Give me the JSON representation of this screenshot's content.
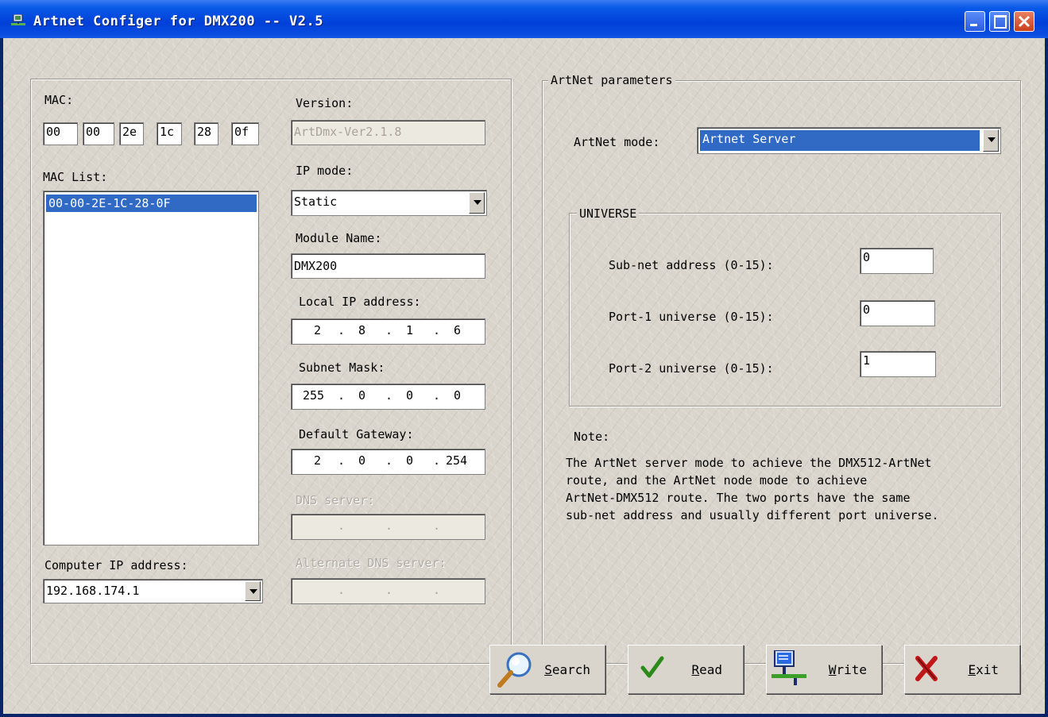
{
  "window": {
    "title": "Artnet Configer for DMX200 -- V2.5"
  },
  "left": {
    "mac_label": "MAC:",
    "mac_octets": [
      "00",
      "00",
      "2e",
      "1c",
      "28",
      "0f"
    ],
    "mac_list_label": "MAC List:",
    "mac_list_items": [
      "00-00-2E-1C-28-0F"
    ],
    "computer_ip_label": "Computer IP address:",
    "computer_ip_value": "192.168.174.1"
  },
  "middle": {
    "version_label": "Version:",
    "version_value": "ArtDmx-Ver2.1.8",
    "ip_mode_label": "IP mode:",
    "ip_mode_value": "Static",
    "module_name_label": "Module Name:",
    "module_name_value": "DMX200",
    "local_ip_label": "Local IP address:",
    "local_ip": [
      "2",
      "8",
      "1",
      "6"
    ],
    "subnet_mask_label": "Subnet Mask:",
    "subnet_mask": [
      "255",
      "0",
      "0",
      "0"
    ],
    "gateway_label": "Default Gateway:",
    "gateway": [
      "2",
      "0",
      "0",
      "254"
    ],
    "dns_label": "DNS server:",
    "alt_dns_label": "Alternate DNS server:"
  },
  "artnet": {
    "group_label": "ArtNet parameters",
    "mode_label": "ArtNet mode:",
    "mode_value": "Artnet Server",
    "universe_group_label": "UNIVERSE",
    "subnet_label": "Sub-net address (0-15):",
    "subnet_value": "0",
    "port1_label": "Port-1 universe (0-15):",
    "port1_value": "0",
    "port2_label": "Port-2 universe (0-15):",
    "port2_value": "1",
    "note_label": "Note:",
    "note_lines": [
      "The ArtNet server mode to achieve the DMX512-ArtNet",
      "route, and the ArtNet node mode to achieve",
      "ArtNet-DMX512 route. The two ports have the same",
      "sub-net address and usually different port universe."
    ]
  },
  "buttons": {
    "search_first": "S",
    "search_rest": "earch",
    "read_first": "R",
    "read_rest": "ead",
    "write_first": "W",
    "write_rest": "rite",
    "exit_first": "E",
    "exit_rest": "xit"
  },
  "icons": [
    "app-icon",
    "minimize-icon",
    "maximize-icon",
    "close-icon",
    "magnifier-icon",
    "checkmark-icon",
    "network-computer-icon",
    "red-x-icon"
  ]
}
